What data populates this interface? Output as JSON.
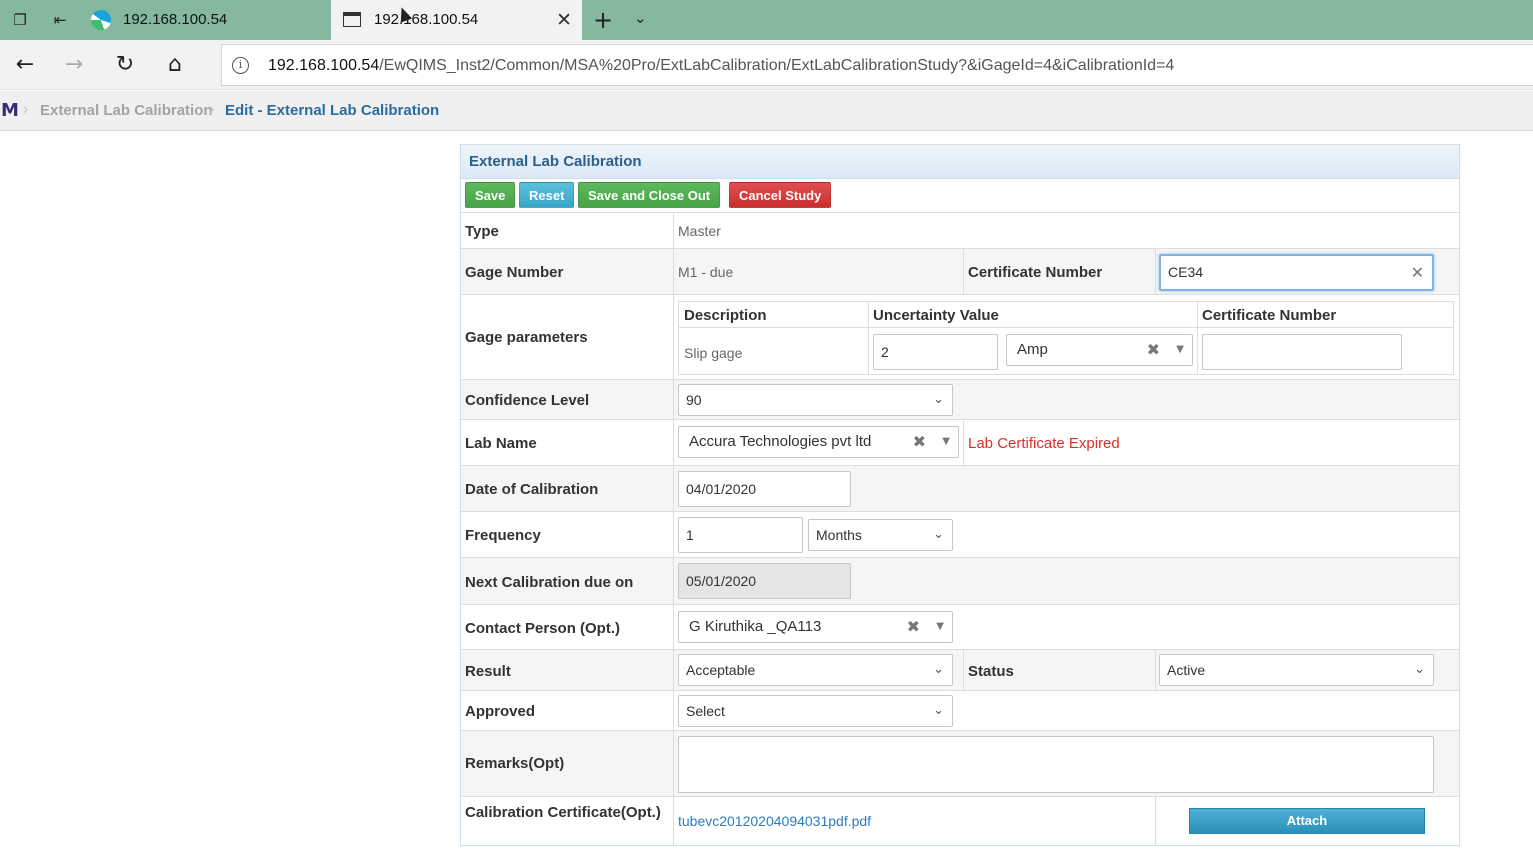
{
  "browser": {
    "tabs": [
      {
        "title": "192.168.100.54",
        "active": false
      },
      {
        "title": "192.168.100.54",
        "active": true
      }
    ],
    "url_host": "192.168.100.54",
    "url_path": "/EwQIMS_Inst2/Common/MSA%20Pro/ExtLabCalibration/ExtLabCalibrationStudy?&iGageId=4&iCalibrationId=4"
  },
  "breadcrumb": {
    "logo": "M",
    "items": [
      "External Lab Calibration",
      "Edit - External Lab Calibration"
    ]
  },
  "panel": {
    "title": "External Lab Calibration"
  },
  "toolbar": {
    "save": "Save",
    "reset": "Reset",
    "save_close": "Save and Close Out",
    "cancel": "Cancel Study"
  },
  "form": {
    "type": {
      "label": "Type",
      "value": "Master"
    },
    "gage_number": {
      "label": "Gage Number",
      "value": "M1 - due"
    },
    "certificate_number": {
      "label": "Certificate Number",
      "value": "CE34"
    },
    "gage_parameters": {
      "label": "Gage parameters",
      "headers": [
        "Description",
        "Uncertainty Value",
        "Certificate Number"
      ],
      "rows": [
        {
          "description": "Slip gage",
          "uncertainty": "2",
          "unit": "Amp",
          "certificate": ""
        }
      ]
    },
    "confidence_level": {
      "label": "Confidence Level",
      "value": "90"
    },
    "lab_name": {
      "label": "Lab Name",
      "value": "Accura Technologies pvt ltd",
      "warning": "Lab Certificate Expired"
    },
    "date_of_calibration": {
      "label": "Date of Calibration",
      "value": "04/01/2020"
    },
    "frequency": {
      "label": "Frequency",
      "value": "1",
      "unit": "Months"
    },
    "next_calibration": {
      "label": "Next Calibration due on",
      "value": "05/01/2020"
    },
    "contact_person": {
      "label": "Contact Person (Opt.)",
      "value": "G Kiruthika _QA113"
    },
    "result": {
      "label": "Result",
      "value": "Acceptable"
    },
    "status": {
      "label": "Status",
      "value": "Active"
    },
    "approved": {
      "label": "Approved",
      "value": "Select"
    },
    "remarks": {
      "label": "Remarks(Opt)",
      "value": ""
    },
    "calibration_certificate": {
      "label": "Calibration Certificate(Opt.)",
      "file": "tubevc20120204094031pdf.pdf",
      "attach": "Attach"
    }
  },
  "colors": {
    "green": "#5cb85c",
    "blue": "#5bc0de",
    "red": "#d9534f",
    "tabstrip": "#86b79f"
  }
}
